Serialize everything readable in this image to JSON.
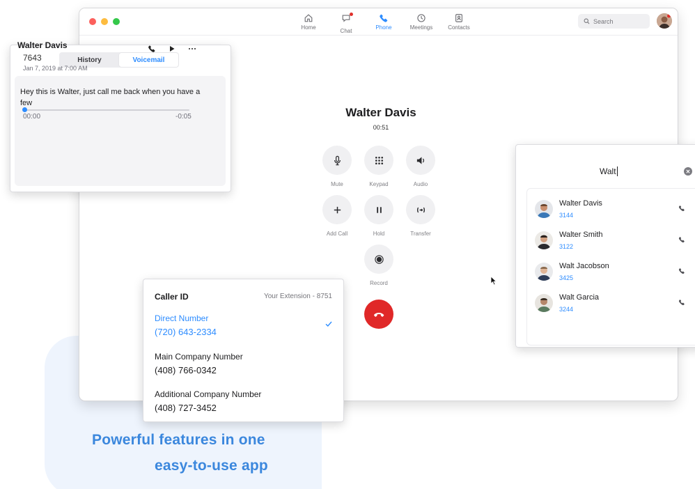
{
  "nav": {
    "items": [
      {
        "label": "Home",
        "icon": "home-icon"
      },
      {
        "label": "Chat",
        "icon": "chat-icon"
      },
      {
        "label": "Phone",
        "icon": "phone-icon"
      },
      {
        "label": "Meetings",
        "icon": "clock-icon"
      },
      {
        "label": "Contacts",
        "icon": "contacts-icon"
      }
    ],
    "active": "Phone"
  },
  "search": {
    "placeholder": "Search"
  },
  "call": {
    "name": "Walter Davis",
    "timer": "00:51",
    "controls": {
      "mute": "Mute",
      "keypad": "Keypad",
      "audio": "Audio",
      "add_call": "Add Call",
      "hold": "Hold",
      "transfer": "Transfer",
      "record": "Record"
    },
    "end_call_color": "#e02828"
  },
  "voicemail": {
    "tabs": {
      "history": "History",
      "voicemail": "Voicemail"
    },
    "active_tab": "Voicemail",
    "entry": {
      "name": "Walter Davis",
      "number": "7643",
      "date": "Jan 7, 2019 at 7:00 AM",
      "transcript": "Hey this is Walter, just call me back when you have a few",
      "time_elapsed": "00:00",
      "time_remaining": "-0:05",
      "progress": 0.0
    }
  },
  "caller_id": {
    "title": "Caller ID",
    "extension": "Your Extension - 8751",
    "options": [
      {
        "label": "Direct Number",
        "number": "(720) 643-2334",
        "selected": true
      },
      {
        "label": "Main Company Number",
        "number": "(408) 766-0342",
        "selected": false
      },
      {
        "label": "Additional Company Number",
        "number": "(408) 727-3452",
        "selected": false
      }
    ]
  },
  "contact_search": {
    "query": "Walt",
    "results": [
      {
        "name": "Walter Davis",
        "ext": "3144"
      },
      {
        "name": "Walter Smith",
        "ext": "3122"
      },
      {
        "name": "Walt Jacobson",
        "ext": "3425"
      },
      {
        "name": "Walt Garcia",
        "ext": "3244"
      }
    ]
  },
  "tagline": {
    "line1": "Powerful features in one",
    "line2": "easy-to-use app"
  },
  "colors": {
    "accent": "#2d8cff",
    "tagline": "#3b87dd",
    "blob": "#eef4fd"
  }
}
